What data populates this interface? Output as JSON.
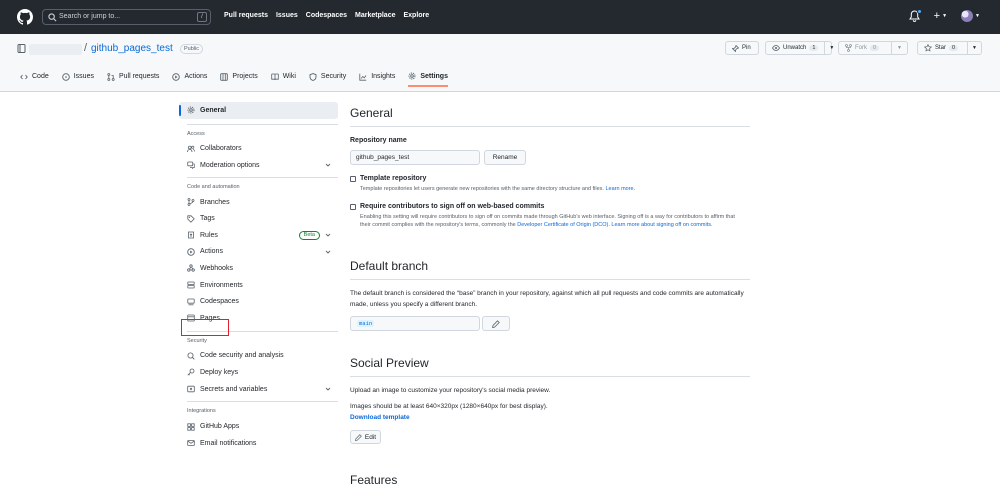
{
  "header": {
    "search_placeholder": "Search or jump to...",
    "search_shortcut": "/",
    "nav": [
      "Pull requests",
      "Issues",
      "Codespaces",
      "Marketplace",
      "Explore"
    ]
  },
  "repo": {
    "name": "github_pages_test",
    "visibility": "Public",
    "pin_label": "Pin",
    "unwatch_label": "Unwatch",
    "unwatch_count": "1",
    "fork_label": "Fork",
    "fork_count": "0",
    "star_label": "Star",
    "star_count": "0",
    "tabs": [
      {
        "label": "Code",
        "icon": "code-icon"
      },
      {
        "label": "Issues",
        "icon": "issue-icon"
      },
      {
        "label": "Pull requests",
        "icon": "pull-request-icon"
      },
      {
        "label": "Actions",
        "icon": "play-icon"
      },
      {
        "label": "Projects",
        "icon": "table-icon"
      },
      {
        "label": "Wiki",
        "icon": "book-icon"
      },
      {
        "label": "Security",
        "icon": "shield-icon"
      },
      {
        "label": "Insights",
        "icon": "graph-icon"
      },
      {
        "label": "Settings",
        "icon": "gear-icon"
      }
    ]
  },
  "sidebar": {
    "general": "General",
    "access_heading": "Access",
    "collaborators": "Collaborators",
    "moderation": "Moderation options",
    "code_heading": "Code and automation",
    "branches": "Branches",
    "tags": "Tags",
    "rules": "Rules",
    "rules_badge": "Beta",
    "actions": "Actions",
    "webhooks": "Webhooks",
    "environments": "Environments",
    "codespaces": "Codespaces",
    "pages": "Pages",
    "security_heading": "Security",
    "code_security": "Code security and analysis",
    "deploy_keys": "Deploy keys",
    "secrets": "Secrets and variables",
    "integrations_heading": "Integrations",
    "github_apps": "GitHub Apps",
    "email_notifications": "Email notifications"
  },
  "main": {
    "general_title": "General",
    "repo_name_label": "Repository name",
    "repo_name_value": "github_pages_test",
    "rename_label": "Rename",
    "template_label": "Template repository",
    "template_note": "Template repositories let users generate new repositories with the same directory structure and files.",
    "learn_more": "Learn more.",
    "signoff_label": "Require contributors to sign off on web-based commits",
    "signoff_note": "Enabling this setting will require contributors to sign off on commits made through GitHub's web interface. Signing off is a way for contributors to affirm that their commit complies with the repository's terms, commonly the",
    "dco_link": "Developer Certificate of Origin (DCO).",
    "signoff_learn": "Learn more about signing off on commits.",
    "default_branch_title": "Default branch",
    "default_branch_text": "The default branch is considered the “base” branch in your repository, against which all pull requests and code commits are automatically made, unless you specify a different branch.",
    "default_branch_value": "main",
    "social_title": "Social Preview",
    "social_text1": "Upload an image to customize your repository's social media preview.",
    "social_text2": "Images should be at least 640×320px (1280×640px for best display).",
    "download_template": "Download template",
    "edit_label": "Edit",
    "features_title": "Features"
  }
}
